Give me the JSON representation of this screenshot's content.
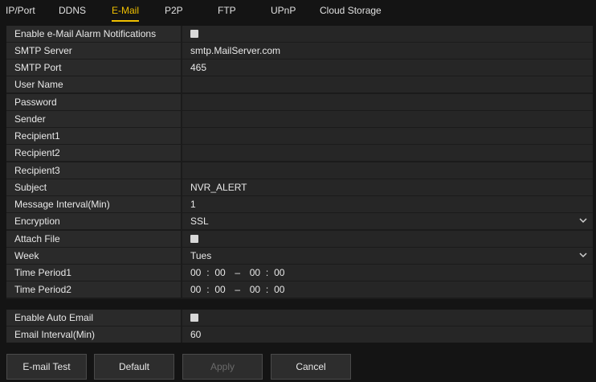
{
  "tabs": [
    {
      "label": "IP/Port"
    },
    {
      "label": "DDNS"
    },
    {
      "label": "E-Mail"
    },
    {
      "label": "P2P"
    },
    {
      "label": "FTP"
    },
    {
      "label": "UPnP"
    },
    {
      "label": "Cloud Storage"
    }
  ],
  "active_tab": "E-Mail",
  "form": {
    "enable_alarm": {
      "label": "Enable e-Mail Alarm Notifications",
      "checked": false
    },
    "smtp_server": {
      "label": "SMTP Server",
      "value": "smtp.MailServer.com"
    },
    "smtp_port": {
      "label": "SMTP Port",
      "value": "465"
    },
    "user_name": {
      "label": "User Name",
      "value": ""
    },
    "password": {
      "label": "Password",
      "value": ""
    },
    "sender": {
      "label": "Sender",
      "value": ""
    },
    "recipient1": {
      "label": "Recipient1",
      "value": ""
    },
    "recipient2": {
      "label": "Recipient2",
      "value": ""
    },
    "recipient3": {
      "label": "Recipient3",
      "value": ""
    },
    "subject": {
      "label": "Subject",
      "value": "NVR_ALERT"
    },
    "message_interval": {
      "label": "Message Interval(Min)",
      "value": "1"
    },
    "encryption": {
      "label": "Encryption",
      "value": "SSL"
    },
    "attach_file": {
      "label": "Attach File",
      "checked": false
    },
    "week": {
      "label": "Week",
      "value": "Tues"
    },
    "time_period1": {
      "label": "Time Period1",
      "start_h": "00",
      "start_m": "00",
      "end_h": "00",
      "end_m": "00"
    },
    "time_period2": {
      "label": "Time Period2",
      "start_h": "00",
      "start_m": "00",
      "end_h": "00",
      "end_m": "00"
    }
  },
  "auto": {
    "enable_auto_email": {
      "label": "Enable Auto Email",
      "checked": false
    },
    "email_interval": {
      "label": "Email Interval(Min)",
      "value": "60"
    }
  },
  "buttons": {
    "email_test": "E-mail Test",
    "default": "Default",
    "apply": "Apply",
    "cancel": "Cancel"
  },
  "colors": {
    "accent": "#f0c000",
    "background": "#141414"
  },
  "icons": {
    "dropdown": "chevron-down-icon",
    "checkbox": "checkbox-icon"
  }
}
